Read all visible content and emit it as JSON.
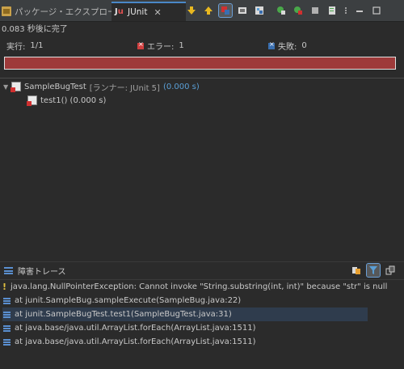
{
  "tabs": {
    "package_explorer": "パッケージ・エクスプローラー",
    "junit": "JUnit",
    "close_glyph": "✕"
  },
  "toolbar_icons": [
    "next-failure",
    "previous-failure",
    "show-failures-only",
    "scroll-lock",
    "history",
    "rerun",
    "rerun-failed-first",
    "stop",
    "test-run-history",
    "view-menu",
    "minimize",
    "maximize"
  ],
  "status": "0.083 秒後に完了",
  "counters": {
    "runs_label": "実行:",
    "runs_value": "1/1",
    "errors_label": "エラー:",
    "errors_value": "1",
    "failures_label": "失敗:",
    "failures_value": "0"
  },
  "progress": {
    "fraction": 1.0,
    "color": "#9e3a3a"
  },
  "tree": {
    "suite_name": "SampleBugTest",
    "suite_runner": "[ランナー: JUnit 5]",
    "suite_time": "(0.000 s)",
    "test_label": "test1() (0.000 s)"
  },
  "trace_panel": {
    "title": "障害トレース"
  },
  "trace_lines": [
    "java.lang.NullPointerException: Cannot invoke \"String.substring(int, int)\" because \"str\" is null",
    "at junit.SampleBug.sampleExecute(SampleBug.java:22)",
    "at junit.SampleBugTest.test1(SampleBugTest.java:31)",
    "at java.base/java.util.ArrayList.forEach(ArrayList.java:1511)",
    "at java.base/java.util.ArrayList.forEach(ArrayList.java:1511)"
  ],
  "colors": {
    "accent": "#4a88c7",
    "error": "#d04040",
    "progress_error": "#9e3a3a",
    "link_time": "#5a9fd6"
  }
}
